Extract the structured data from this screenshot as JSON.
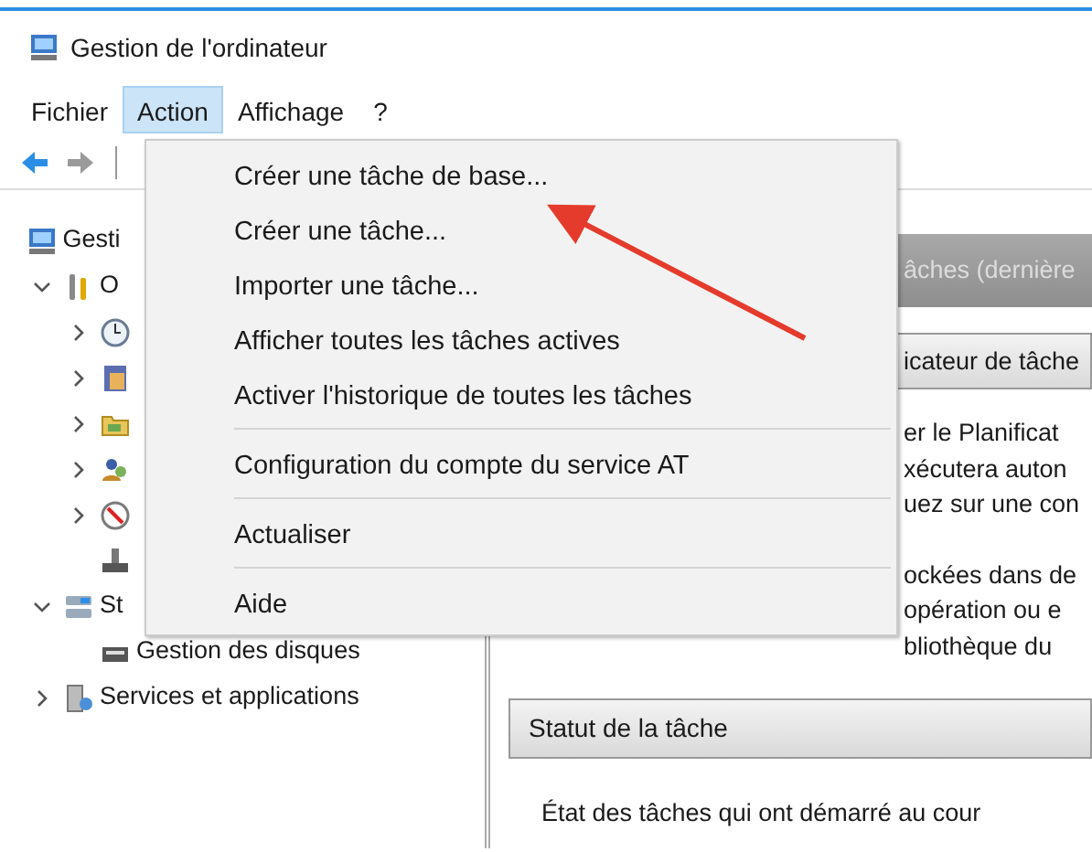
{
  "window": {
    "title": "Gestion de l'ordinateur"
  },
  "menu_bar": [
    {
      "label": "Fichier",
      "selected": false
    },
    {
      "label": "Action",
      "selected": true
    },
    {
      "label": "Affichage",
      "selected": false
    },
    {
      "label": "?",
      "selected": false
    }
  ],
  "toolbar": [
    {
      "kind": "back",
      "disabled": false
    },
    {
      "kind": "forward",
      "disabled": true
    }
  ],
  "tree": [
    {
      "label": "Gesti",
      "kind": "computer",
      "children": [
        {
          "label": "O",
          "kind": "tools",
          "expanded": true,
          "children": [
            {
              "kind": "clock",
              "expanded": false
            },
            {
              "kind": "event",
              "expanded": false
            },
            {
              "kind": "folder",
              "expanded": false
            },
            {
              "kind": "users",
              "expanded": false
            },
            {
              "kind": "gauge",
              "expanded": false
            },
            {
              "kind": "device"
            }
          ]
        },
        {
          "label": "St",
          "kind": "storage",
          "expanded": true,
          "children": [
            {
              "label": "Gestion des disques",
              "kind": "disk"
            }
          ]
        },
        {
          "label": "Services et applications",
          "kind": "services",
          "expanded": false
        }
      ]
    }
  ],
  "right_pane": {
    "header": "âches (dernière",
    "section_header": "icateur de tâche",
    "description_paragraphs": [
      [
        "er le Planificat",
        "xécutera auton",
        "uez sur une con"
      ],
      [
        "ockées dans de",
        "opération ou e",
        "bliothèque du"
      ]
    ],
    "status": {
      "header": "Statut de la tâche",
      "text": "État des tâches qui ont démarré au cour"
    }
  },
  "action_menu": [
    {
      "kind": "item",
      "label": "Créer une tâche de base..."
    },
    {
      "kind": "item",
      "label": "Créer une tâche..."
    },
    {
      "kind": "item",
      "label": "Importer une tâche..."
    },
    {
      "kind": "item",
      "label": "Afficher toutes les tâches actives"
    },
    {
      "kind": "item",
      "label": "Activer l'historique de toutes les tâches"
    },
    {
      "kind": "separator"
    },
    {
      "kind": "item",
      "label": "Configuration du compte du service AT"
    },
    {
      "kind": "separator"
    },
    {
      "kind": "item",
      "label": "Actualiser"
    },
    {
      "kind": "separator"
    },
    {
      "kind": "item",
      "label": "Aide"
    }
  ]
}
